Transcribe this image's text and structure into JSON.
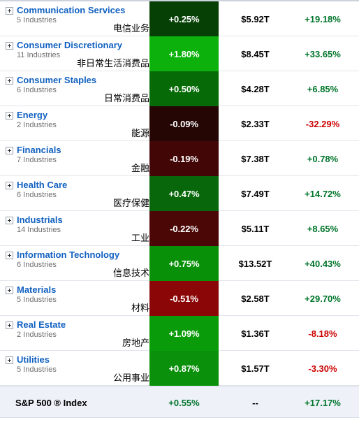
{
  "colors": {
    "positive_text": "#00752b",
    "negative_text": "#cc0000",
    "link": "#1261c1",
    "index_row_bg": "#eef1f8"
  },
  "table": {
    "rows": [
      {
        "sector": "Communication Services",
        "industries": "5 Industries",
        "cn": "电信业务",
        "change": "+0.25%",
        "change_value": 0.25,
        "cell_color": "#064005",
        "market_cap": "$5.92T",
        "ytd": "+19.18%",
        "ytd_sign": "pos"
      },
      {
        "sector": "Consumer Discretionary",
        "industries": "11 Industries",
        "cn": "非日常生活消费品",
        "change": "+1.80%",
        "change_value": 1.8,
        "cell_color": "#0cb10c",
        "market_cap": "$8.45T",
        "ytd": "+33.65%",
        "ytd_sign": "pos"
      },
      {
        "sector": "Consumer Staples",
        "industries": "6 Industries",
        "cn": "日常消费品",
        "change": "+0.50%",
        "change_value": 0.5,
        "cell_color": "#066b06",
        "market_cap": "$4.28T",
        "ytd": "+6.85%",
        "ytd_sign": "pos"
      },
      {
        "sector": "Energy",
        "industries": "2 Industries",
        "cn": "能源",
        "change": "-0.09%",
        "change_value": -0.09,
        "cell_color": "#250605",
        "market_cap": "$2.33T",
        "ytd": "-32.29%",
        "ytd_sign": "neg"
      },
      {
        "sector": "Financials",
        "industries": "7 Industries",
        "cn": "金融",
        "change": "-0.19%",
        "change_value": -0.19,
        "cell_color": "#430606",
        "market_cap": "$7.38T",
        "ytd": "+0.78%",
        "ytd_sign": "pos"
      },
      {
        "sector": "Health Care",
        "industries": "6 Industries",
        "cn": "医疗保健",
        "change": "+0.47%",
        "change_value": 0.47,
        "cell_color": "#07670a",
        "market_cap": "$7.49T",
        "ytd": "+14.72%",
        "ytd_sign": "pos"
      },
      {
        "sector": "Industrials",
        "industries": "14 Industries",
        "cn": "工业",
        "change": "-0.22%",
        "change_value": -0.22,
        "cell_color": "#4b0705",
        "market_cap": "$5.11T",
        "ytd": "+8.65%",
        "ytd_sign": "pos"
      },
      {
        "sector": "Information Technology",
        "industries": "6 Industries",
        "cn": "信息技术",
        "change": "+0.75%",
        "change_value": 0.75,
        "cell_color": "#089108",
        "market_cap": "$13.52T",
        "ytd": "+40.43%",
        "ytd_sign": "pos"
      },
      {
        "sector": "Materials",
        "industries": "5 Industries",
        "cn": "材料",
        "change": "-0.51%",
        "change_value": -0.51,
        "cell_color": "#8b0606",
        "market_cap": "$2.58T",
        "ytd": "+29.70%",
        "ytd_sign": "pos"
      },
      {
        "sector": "Real Estate",
        "industries": "2 Industries",
        "cn": "房地产",
        "change": "+1.09%",
        "change_value": 1.09,
        "cell_color": "#099b09",
        "market_cap": "$1.36T",
        "ytd": "-8.18%",
        "ytd_sign": "neg"
      },
      {
        "sector": "Utilities",
        "industries": "5 Industries",
        "cn": "公用事业",
        "change": "+0.87%",
        "change_value": 0.87,
        "cell_color": "#0a900a",
        "market_cap": "$1.57T",
        "ytd": "-3.30%",
        "ytd_sign": "neg"
      }
    ],
    "index_row": {
      "name": "S&P 500 ® Index",
      "change": "+0.55%",
      "change_sign": "pos",
      "market_cap": "--",
      "ytd": "+17.17%",
      "ytd_sign": "pos"
    }
  },
  "icons": {
    "expander": "plus-box-icon"
  }
}
